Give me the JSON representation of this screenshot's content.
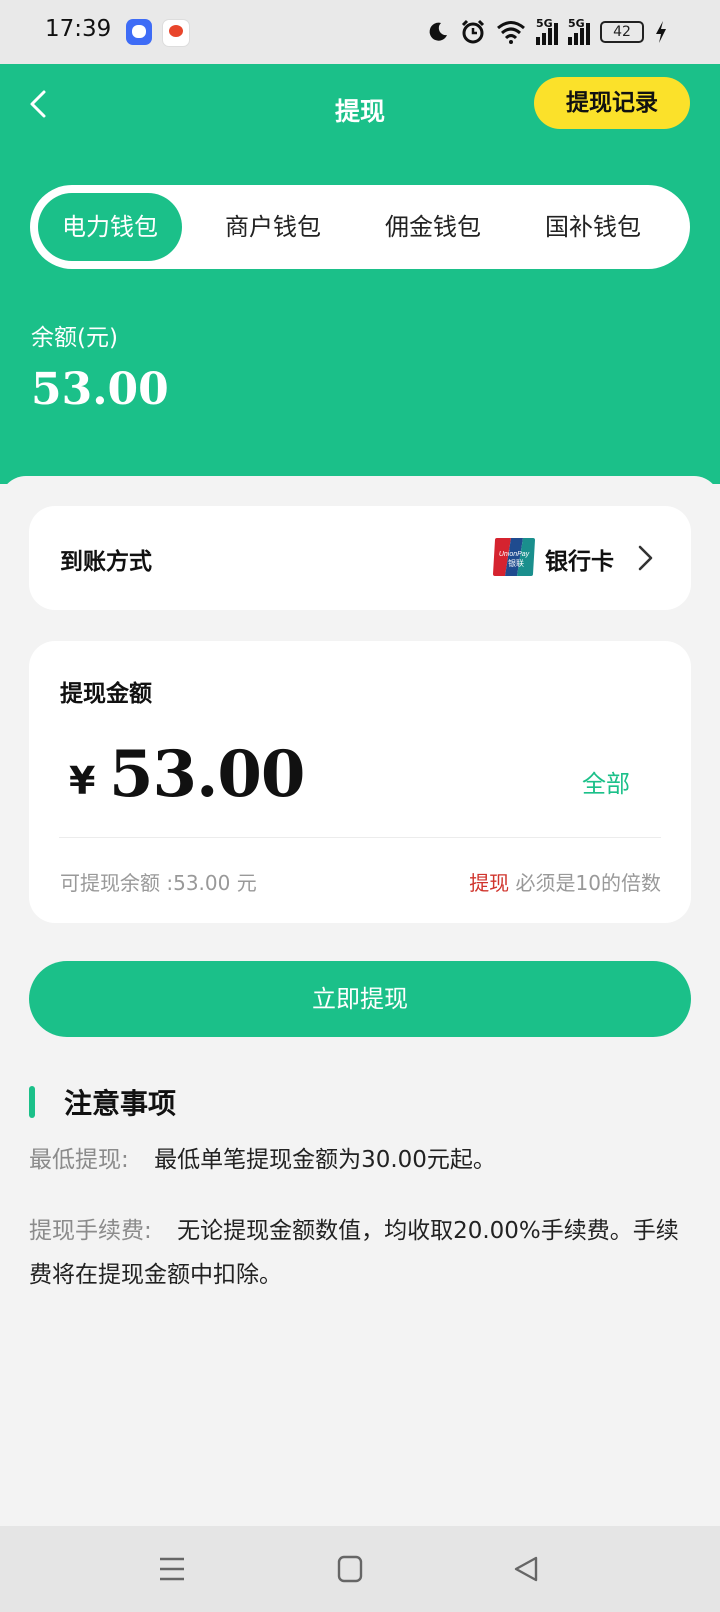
{
  "status_bar": {
    "time": "17:39",
    "signal_label_1": "5G",
    "signal_label_2": "5G",
    "battery": "42",
    "icons": [
      "moon-icon",
      "alarm-icon",
      "wifi-icon",
      "signal-icon",
      "signal-icon",
      "battery-icon",
      "charging-icon"
    ]
  },
  "header": {
    "title": "提现",
    "record_button": "提现记录"
  },
  "tabs": [
    {
      "label": "电力钱包",
      "active": true
    },
    {
      "label": "商户钱包",
      "active": false
    },
    {
      "label": "佣金钱包",
      "active": false
    },
    {
      "label": "国补钱包",
      "active": false
    }
  ],
  "balance": {
    "label": "余额(元)",
    "value": "53.00"
  },
  "method": {
    "label": "到账方式",
    "value": "银行卡",
    "icon": "unionpay-icon"
  },
  "amount": {
    "label": "提现金额",
    "currency": "¥",
    "value": "53.00",
    "all_button": "全部",
    "available": "可提现余额 :53.00 元",
    "rule_highlight": "提现",
    "rule_rest": " 必须是10的倍数"
  },
  "submit_button": "立即提现",
  "notes": {
    "title": "注意事项",
    "items": [
      {
        "key": "最低提现:",
        "text": "最低单笔提现金额为30.00元起。"
      },
      {
        "key": "提现手续费:",
        "text": "无论提现金额数值，均收取20.00%手续费。手续费将在提现金额中扣除。"
      }
    ]
  },
  "colors": {
    "brand_green": "#1bc089",
    "record_yellow": "#fbe12a",
    "highlight_red": "#d0342c"
  }
}
